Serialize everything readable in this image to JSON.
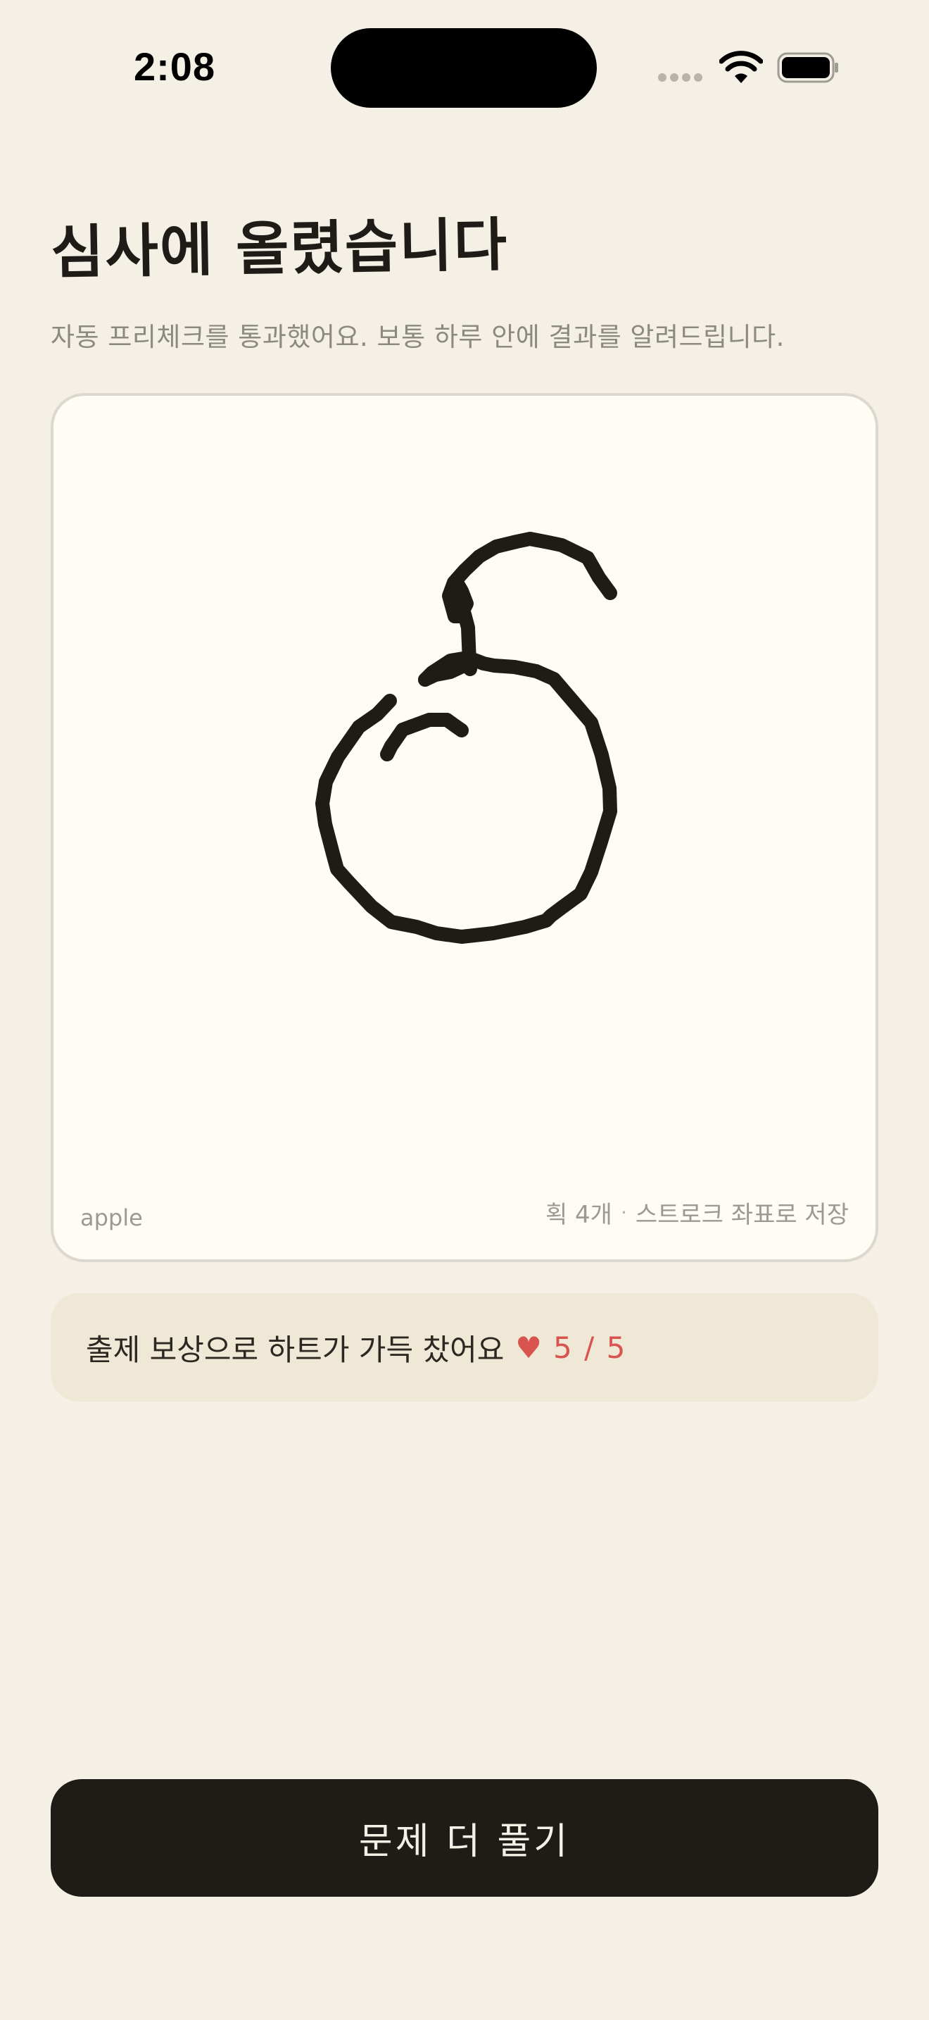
{
  "status_bar": {
    "time": "2:08",
    "icons": [
      "signal-icon",
      "wifi-icon",
      "battery-icon"
    ]
  },
  "header": {
    "title": "심사에 올렸습니다",
    "subtitle": "자동 프리체크를 통과했어요. 보통 하루 안에 결과를 알려드립니다."
  },
  "drawing_card": {
    "category": "apple",
    "stroke_count": "획 4개",
    "separator": "·",
    "storage_note": "스트로크 좌표로 저장"
  },
  "reward": {
    "text": "출제 보상으로 하트가 가득 찼어요",
    "heart_icon": "heart-icon",
    "hearts": "5 / 5",
    "heart_color": "#d9544f"
  },
  "actions": {
    "more_label": "문제 더 풀기"
  },
  "colors": {
    "background": "#f5f0e6",
    "card": "#fefcf5",
    "ink": "#1f1c18",
    "banner": "#f0e8d6",
    "muted_text": "#8c8882"
  }
}
